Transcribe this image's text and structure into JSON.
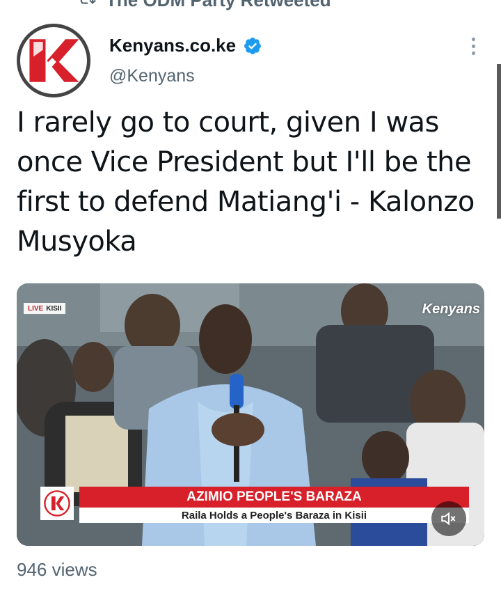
{
  "retweet_bar": {
    "icon": "retweet-icon",
    "label": "The ODM Party Retweeted"
  },
  "author": {
    "display_name": "Kenyans.co.ke",
    "handle": "@Kenyans",
    "verified": true,
    "avatar_icon": "kenyans-k-logo"
  },
  "tweet": {
    "text": "I rarely go to court, given I was once Vice President but I'll be the first to defend Matiang'i - Kalonzo Musyoka"
  },
  "media": {
    "type": "video",
    "live_badge": "LIVE",
    "live_location": "KISII",
    "watermark": "Kenyans",
    "lower_third_title": "AZIMIO PEOPLE'S BARAZA",
    "lower_third_subtitle": "Raila Holds a People's Baraza in Kisii",
    "mute_icon": "speaker-muted-icon"
  },
  "stats": {
    "views": "946 views"
  },
  "colors": {
    "verified_blue": "#1d9bf0",
    "brand_red": "#d7202a",
    "muted_text": "#536471"
  }
}
